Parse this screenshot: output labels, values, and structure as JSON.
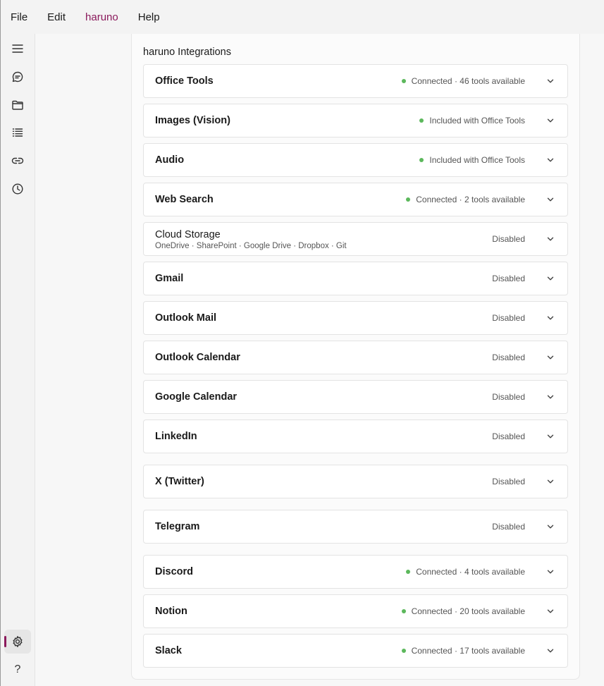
{
  "colors": {
    "brand": "#8b1a5c",
    "connected_dot": "#5cb85c"
  },
  "menu": {
    "file": "File",
    "edit": "Edit",
    "brand": "haruno",
    "help": "Help"
  },
  "rail": {
    "icons": [
      "menu-icon",
      "chat-icon",
      "folder-icon",
      "list-icon",
      "link-icon",
      "history-icon",
      "settings-icon",
      "help-icon"
    ],
    "active": "settings-icon",
    "help_glyph": "?"
  },
  "panel": {
    "title": "haruno Integrations",
    "integrations": [
      {
        "name": "Office Tools",
        "status": "Connected · 46 tools available",
        "connected": true
      },
      {
        "name": "Images (Vision)",
        "status": "Included with Office Tools",
        "connected": true
      },
      {
        "name": "Audio",
        "status": "Included with Office Tools",
        "connected": true
      },
      {
        "name": "Web Search",
        "status": "Connected · 2 tools available",
        "connected": true
      },
      {
        "name": "Cloud Storage",
        "subtitle": "OneDrive · SharePoint · Google Drive · Dropbox · Git",
        "status": "Disabled",
        "connected": false
      },
      {
        "name": "Gmail",
        "status": "Disabled",
        "connected": false
      },
      {
        "name": "Outlook Mail",
        "status": "Disabled",
        "connected": false
      },
      {
        "name": "Outlook Calendar",
        "status": "Disabled",
        "connected": false
      },
      {
        "name": "Google Calendar",
        "status": "Disabled",
        "connected": false
      },
      {
        "name": "LinkedIn",
        "status": "Disabled",
        "connected": false
      },
      {
        "name": "X (Twitter)",
        "status": "Disabled",
        "connected": false
      },
      {
        "name": "Telegram",
        "status": "Disabled",
        "connected": false
      },
      {
        "name": "Discord",
        "status": "Connected · 4 tools available",
        "connected": true
      },
      {
        "name": "Notion",
        "status": "Connected · 20 tools available",
        "connected": true
      },
      {
        "name": "Slack",
        "status": "Connected · 17 tools available",
        "connected": true
      }
    ]
  }
}
